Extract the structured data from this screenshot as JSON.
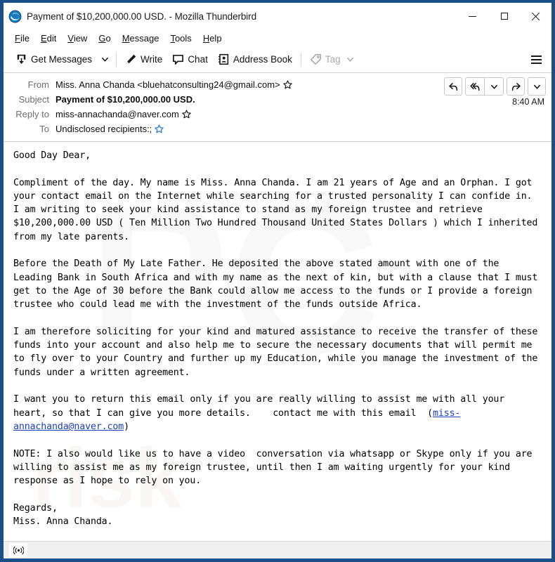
{
  "window": {
    "title": "Payment of $10,200,000.00 USD. - Mozilla Thunderbird",
    "frame_color": "#1b4f8a",
    "controls": {
      "minimize": "Minimize",
      "maximize": "Maximize",
      "close": "Close"
    }
  },
  "menubar": {
    "items": [
      {
        "pre": "",
        "key": "F",
        "post": "ile"
      },
      {
        "pre": "",
        "key": "E",
        "post": "dit"
      },
      {
        "pre": "",
        "key": "V",
        "post": "iew"
      },
      {
        "pre": "",
        "key": "G",
        "post": "o"
      },
      {
        "pre": "",
        "key": "M",
        "post": "essage"
      },
      {
        "pre": "",
        "key": "T",
        "post": "ools"
      },
      {
        "pre": "",
        "key": "H",
        "post": "elp"
      }
    ]
  },
  "toolbar": {
    "get_messages_label": "Get Messages",
    "write_label": "Write",
    "chat_label": "Chat",
    "address_book_label": "Address Book",
    "tag_label": "Tag",
    "tag_disabled": true,
    "app_menu_label": "Application Menu"
  },
  "message_header": {
    "from_label": "From",
    "from_value": "Miss. Anna Chanda <bluehatconsulting24@gmail.com>",
    "subject_label": "Subject",
    "subject_value": "Payment of $10,200,000.00 USD.",
    "reply_to_label": "Reply to",
    "reply_to_value": "miss-annachanda@naver.com",
    "to_label": "To",
    "to_value": "Undisclosed recipients:;",
    "time": "8:40 AM",
    "actions": {
      "reply": "Reply",
      "reply_all": "Reply All",
      "reply_all_more": "More reply options",
      "forward": "Forward",
      "more": "More actions"
    }
  },
  "message_body": {
    "greeting": "Good Day Dear,",
    "paragraph_1": "Compliment of the day. My name is Miss. Anna Chanda. I am 21 years of Age and an Orphan. I got your contact email on the Internet while searching for a trusted personality I can confide in. I am writing to seek your kind assistance to stand as my foreign trustee and retrieve $10,200,000.00 USD ( Ten Million Two Hundred Thousand United States Dollars ) which I inherited from my late parents.",
    "paragraph_2": "Before the Death of My Late Father. He deposited the above stated amount with one of the Leading Bank in South Africa and with my name as the next of kin, but with a clause that I must get to the Age of 30 before the Bank could allow me access to the funds or I provide a foreign trustee who could lead me with the investment of the funds outside Africa.",
    "paragraph_3": "I am therefore soliciting for your kind and matured assistance to receive the transfer of these funds into your account and also help me to secure the necessary documents that will permit me to fly over to your Country and further up my Education, while you manage the investment of the funds under a written agreement.",
    "paragraph_4_before_link": "I want you to return this email only if you are really willing to assist me with all your heart, so that I can give you more details.    contact me with this email  (",
    "paragraph_4_link": "miss-annachanda@naver.com",
    "paragraph_4_after_link": ")",
    "paragraph_5": "NOTE: I also would like us to have a video  conversation via whatsapp or Skype only if you are willing to assist me as my foreign trustee, until then I am waiting urgently for your kind response as I hope to rely on you.",
    "closing": "Regards,",
    "signature": "Miss. Anna Chanda."
  },
  "statusbar": {
    "icon": "rss-broadcast-icon"
  }
}
